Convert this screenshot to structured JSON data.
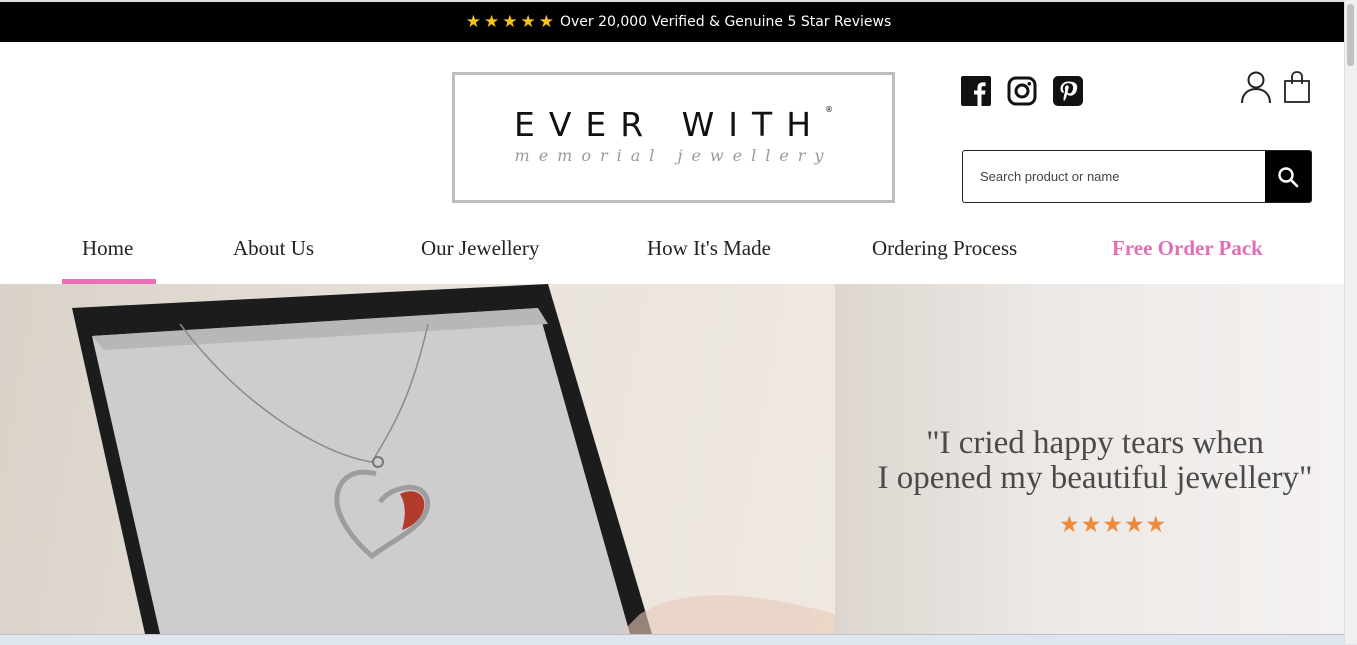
{
  "announcement": {
    "rating_stars": 5,
    "text": "Over 20,000 Verified & Genuine 5 Star Reviews"
  },
  "logo": {
    "main": "EVER WITH",
    "sub": "memorial jewellery"
  },
  "social": [
    "facebook-icon",
    "instagram-icon",
    "pinterest-icon"
  ],
  "header_icons": [
    "account-icon",
    "cart-icon"
  ],
  "search": {
    "placeholder": "Search product or name"
  },
  "nav": {
    "items": [
      {
        "label": "Home",
        "active": true
      },
      {
        "label": "About Us"
      },
      {
        "label": "Our Jewellery"
      },
      {
        "label": "How It's Made"
      },
      {
        "label": "Ordering Process"
      },
      {
        "label": "Free Order Pack",
        "highlight": true
      }
    ]
  },
  "hero": {
    "quote_line1": "\"I cried happy tears when",
    "quote_line2": "I opened my beautiful jewellery\"",
    "quote_rating_stars": 5
  },
  "colors": {
    "accent_pink": "#e06fb6",
    "star_yellow": "#f5c518",
    "star_orange": "#ef8a3b"
  }
}
